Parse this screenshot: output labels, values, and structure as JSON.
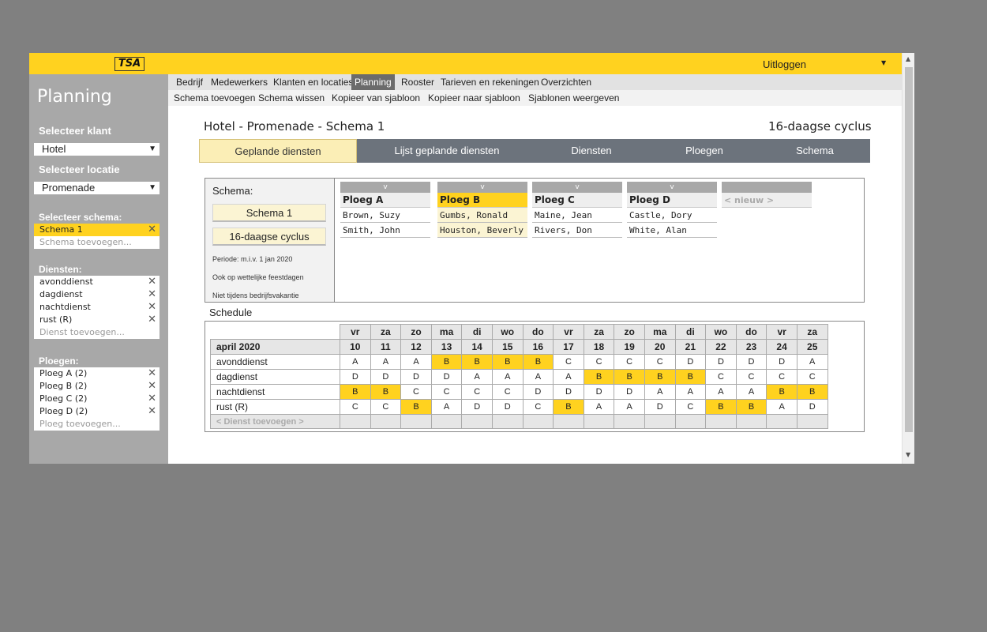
{
  "header": {
    "logo": "TSA",
    "logout": "Uitloggen"
  },
  "sidebar": {
    "title": "Planning",
    "client_label": "Selecteer klant",
    "client_value": "Hotel",
    "location_label": "Selecteer locatie",
    "location_value": "Promenade",
    "schema_label": "Selecteer schema:",
    "schemas": [
      {
        "label": "Schema 1"
      }
    ],
    "schema_add": "Schema toevoegen...",
    "services_label": "Diensten:",
    "services": [
      {
        "label": "avonddienst"
      },
      {
        "label": "dagdienst"
      },
      {
        "label": "nachtdienst"
      },
      {
        "label": "rust (R)"
      }
    ],
    "service_add": "Dienst toevoegen...",
    "crews_label": "Ploegen:",
    "crews": [
      {
        "label": "Ploeg A (2)"
      },
      {
        "label": "Ploeg B (2)"
      },
      {
        "label": "Ploeg C (2)"
      },
      {
        "label": "Ploeg D (2)"
      }
    ],
    "crew_add": "Ploeg toevoegen..."
  },
  "menu": {
    "main": [
      "Bedrijf",
      "Medewerkers",
      "Klanten en locaties",
      "Planning",
      "Rooster",
      "Tarieven en rekeningen",
      "Overzichten"
    ],
    "sub": [
      "Schema toevoegen",
      "Schema wissen",
      "Kopieer van sjabloon",
      "Kopieer naar sjabloon",
      "Sjablonen weergeven"
    ]
  },
  "page": {
    "title": "Hotel - Promenade - Schema 1",
    "cycle": "16-daagse cyclus"
  },
  "tabs": [
    "Geplande diensten",
    "Lijst geplande diensten",
    "Diensten",
    "Ploegen",
    "Schema"
  ],
  "schema_panel": {
    "label": "Schema:",
    "button1": "Schema 1",
    "button2": "16-daagse cyclus",
    "note1": "Periode: m.i.v. 1 jan 2020",
    "note2": "Ook op wettelijke feestdagen",
    "note3": "Niet tijdens bedrijfsvakantie",
    "expand_glyph": "v",
    "crews": [
      {
        "name": "Ploeg A",
        "members": [
          "Brown, Suzy",
          "Smith, John"
        ]
      },
      {
        "name": "Ploeg B",
        "members": [
          "Gumbs, Ronald",
          "Houston, Beverly"
        ]
      },
      {
        "name": "Ploeg C",
        "members": [
          "Maine, Jean",
          "Rivers, Don"
        ]
      },
      {
        "name": "Ploeg D",
        "members": [
          "Castle, Dory",
          "White, Alan"
        ]
      }
    ],
    "new_crew": "< nieuw >"
  },
  "schedule": {
    "title": "Schedule",
    "month": "april 2020",
    "days": [
      "vr",
      "za",
      "zo",
      "ma",
      "di",
      "wo",
      "do",
      "vr",
      "za",
      "zo",
      "ma",
      "di",
      "wo",
      "do",
      "vr",
      "za"
    ],
    "dates": [
      "10",
      "11",
      "12",
      "13",
      "14",
      "15",
      "16",
      "17",
      "18",
      "19",
      "20",
      "21",
      "22",
      "23",
      "24",
      "25"
    ],
    "rows": [
      {
        "label": "avonddienst",
        "cells": [
          "A",
          "A",
          "A",
          "B",
          "B",
          "B",
          "B",
          "C",
          "C",
          "C",
          "C",
          "D",
          "D",
          "D",
          "D",
          "A"
        ]
      },
      {
        "label": "dagdienst",
        "cells": [
          "D",
          "D",
          "D",
          "D",
          "A",
          "A",
          "A",
          "A",
          "B",
          "B",
          "B",
          "B",
          "C",
          "C",
          "C",
          "C"
        ]
      },
      {
        "label": "nachtdienst",
        "cells": [
          "B",
          "B",
          "C",
          "C",
          "C",
          "C",
          "D",
          "D",
          "D",
          "D",
          "A",
          "A",
          "A",
          "A",
          "B",
          "B"
        ]
      },
      {
        "label": "rust (R)",
        "cells": [
          "C",
          "C",
          "B",
          "A",
          "D",
          "D",
          "C",
          "B",
          "A",
          "A",
          "D",
          "C",
          "B",
          "B",
          "A",
          "D"
        ]
      }
    ],
    "add_row": "< Dienst toevoegen >",
    "highlight": "B",
    "highlight_color": "#ffd21f"
  },
  "colors": {
    "accent": "#ffd21f",
    "sidebar": "#a8a8a8",
    "tabbar": "#6c737c",
    "active_tab": "#fbeeb6"
  }
}
